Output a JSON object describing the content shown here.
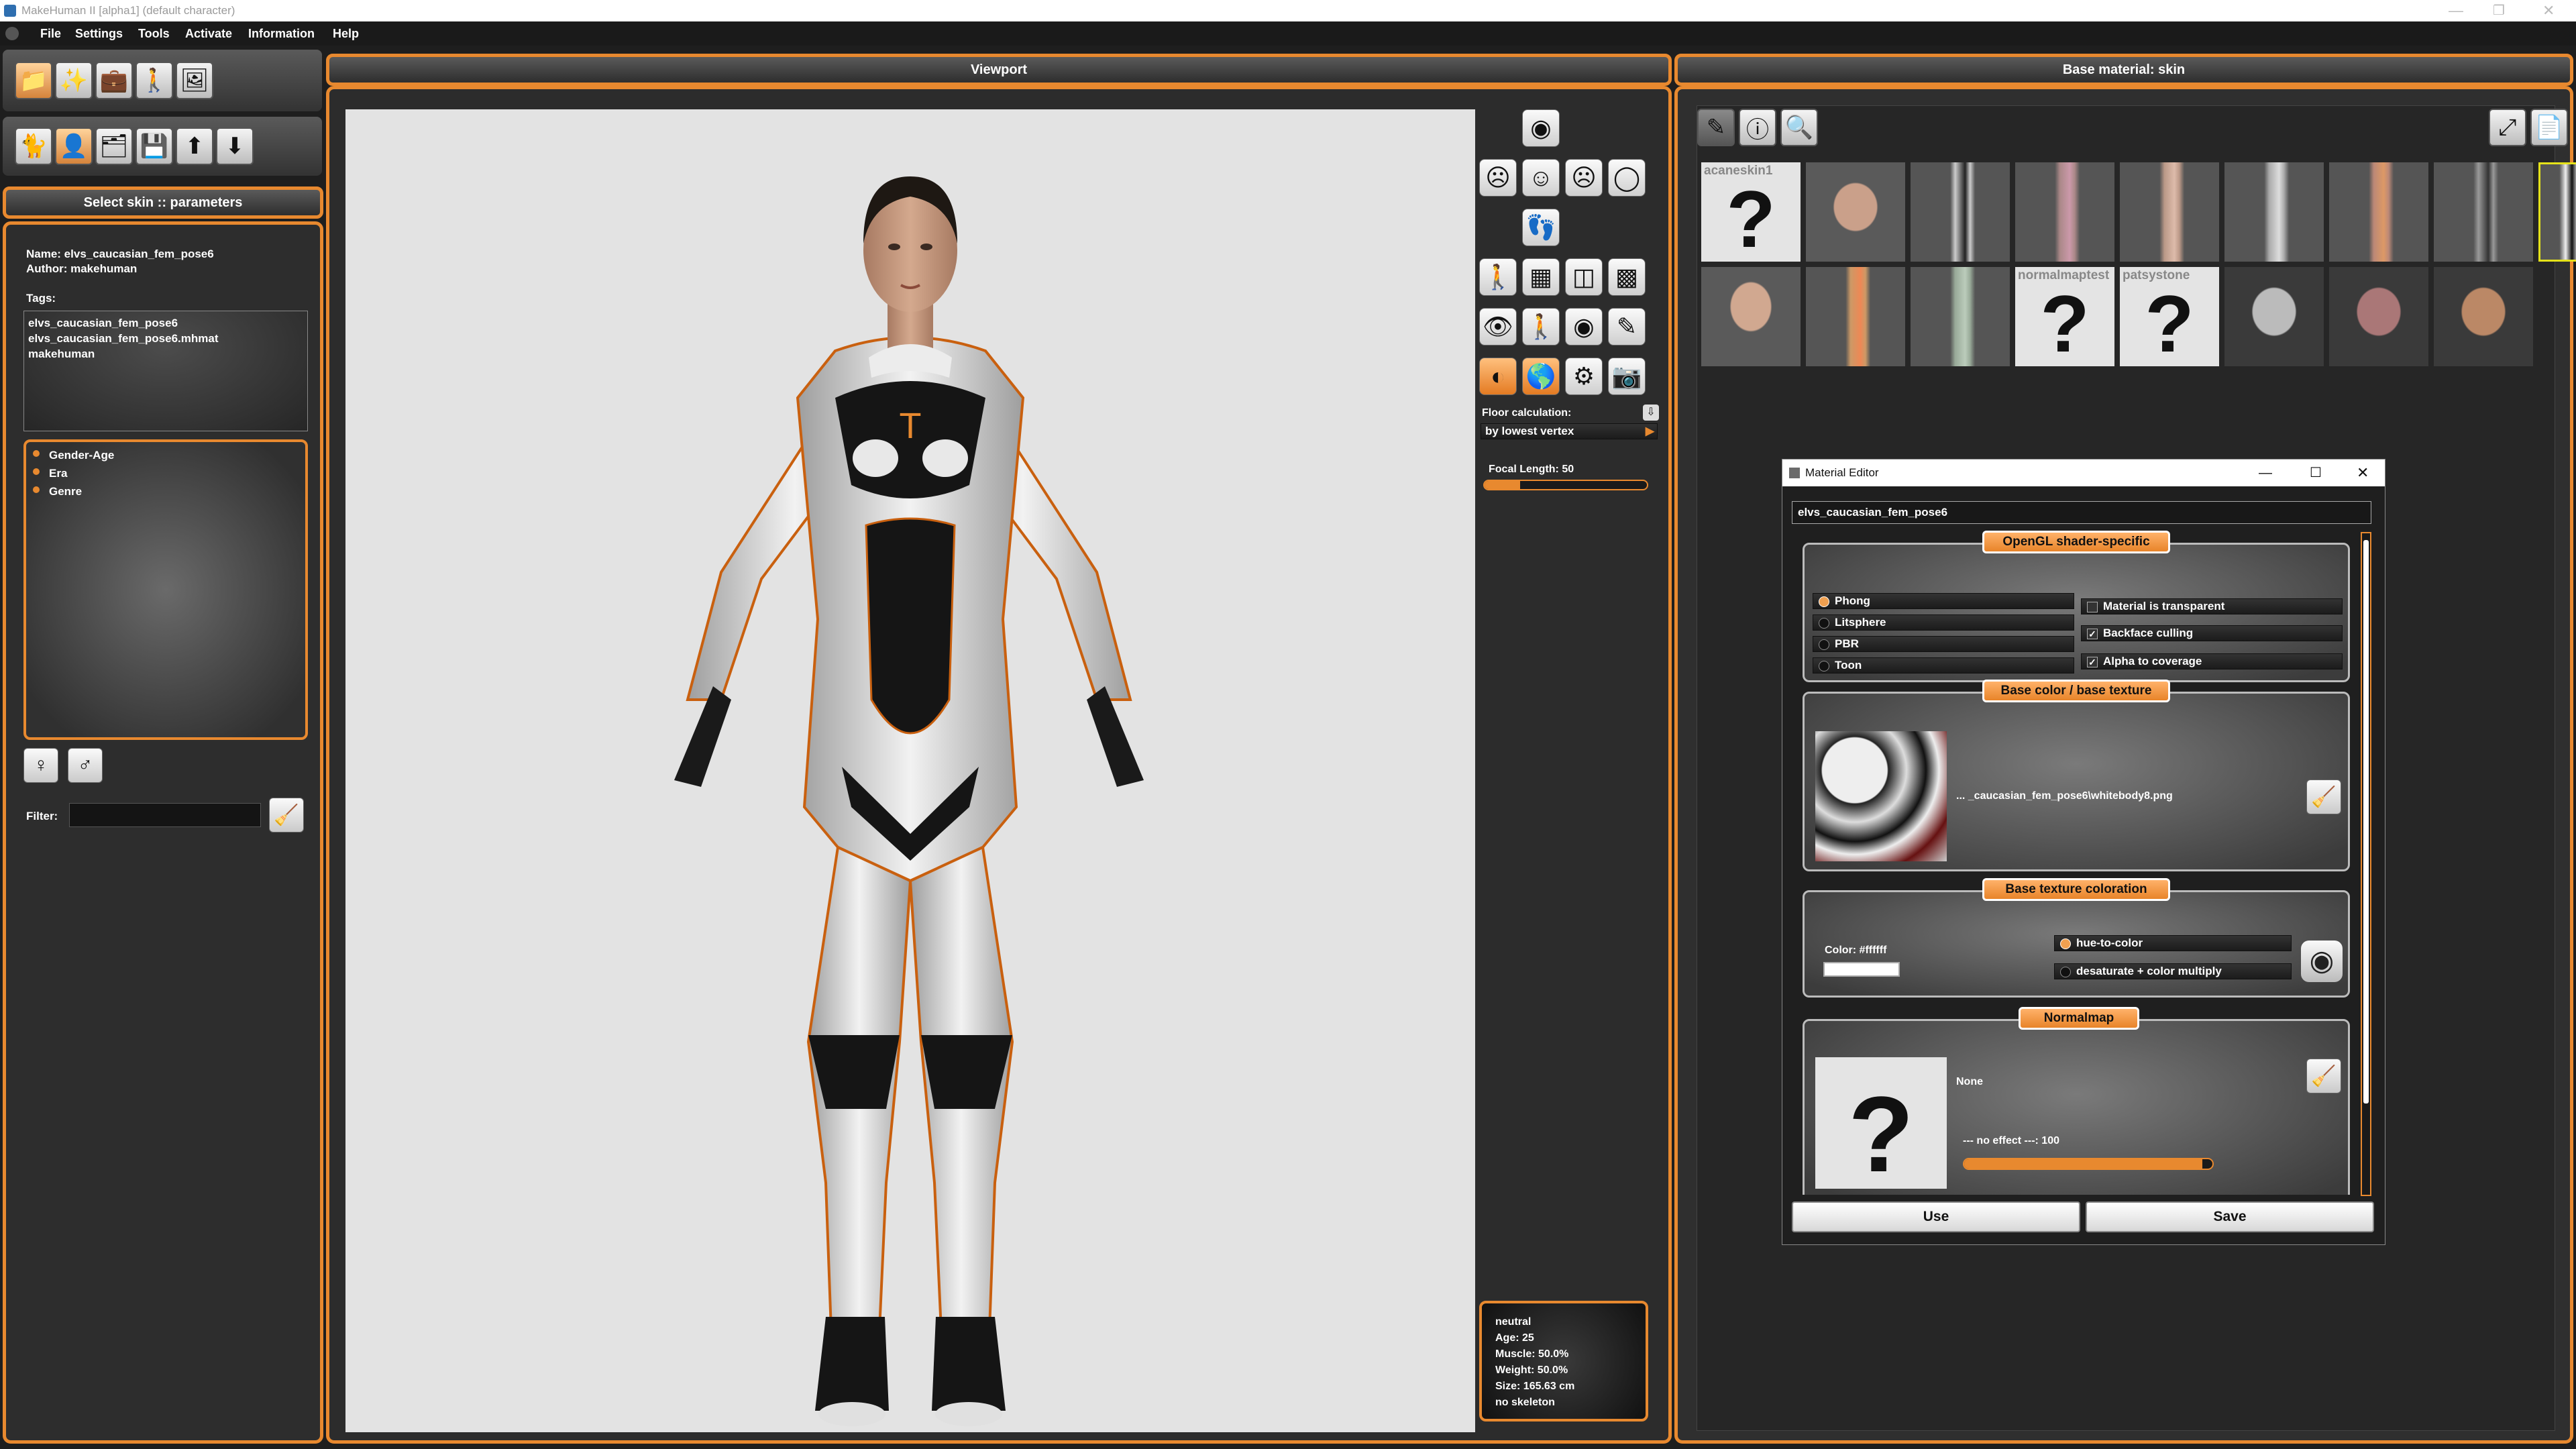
{
  "window": {
    "title": "MakeHuman II [alpha1]  (default character)"
  },
  "menu": [
    "File",
    "Settings",
    "Tools",
    "Activate",
    "Information",
    "Help"
  ],
  "left": {
    "section_title": "Select skin :: parameters",
    "name_line": "Name: elvs_caucasian_fem_pose6",
    "author_line": "Author: makehuman",
    "tags_label": "Tags:",
    "tags": [
      "elvs_caucasian_fem_pose6",
      "elvs_caucasian_fem_pose6.mhmat",
      "makehuman"
    ],
    "categories": [
      "Gender-Age",
      "Era",
      "Genre"
    ],
    "filter_label": "Filter:",
    "filter_value": ""
  },
  "viewport": {
    "title": "Viewport",
    "floor_label": "Floor calculation:",
    "floor_value": "by lowest vertex",
    "focal_label": "Focal Length: 50",
    "focal_level": 0.22,
    "info_lines": [
      "neutral",
      "Age: 25",
      "Muscle: 50.0%",
      "Weight: 50.0%",
      "Size: 165.63 cm",
      "no skeleton"
    ]
  },
  "right": {
    "title": "Base material: skin",
    "grid_labels": {
      "first": "acaneskin1",
      "row2_4": "normalmaptest",
      "row2_5": "patsystone"
    }
  },
  "material_editor": {
    "title": "Material Editor",
    "name_value": "elvs_caucasian_fem_pose6",
    "shader_section": "OpenGL shader-specific",
    "shaders": [
      "Phong",
      "Litsphere",
      "PBR",
      "Toon"
    ],
    "selected_shader": "Phong",
    "options": [
      {
        "label": "Material is transparent",
        "checked": false
      },
      {
        "label": "Backface culling",
        "checked": true
      },
      {
        "label": "Alpha to coverage",
        "checked": true
      }
    ],
    "base_color_section": "Base color / base texture",
    "texture_path": "... _caucasian_fem_pose6\\whitebody8.png",
    "coloration_section": "Base texture coloration",
    "color_label": "Color: #ffffff",
    "color_swatch": "#ffffff",
    "coloration_modes": [
      "hue-to-color",
      "desaturate + color multiply"
    ],
    "normalmap_section": "Normalmap",
    "normalmap_value": "None",
    "normalmap_effect": "--- no effect ---: 100",
    "normalmap_level": 0.96,
    "use_label": "Use",
    "save_label": "Save"
  },
  "colors": {
    "accent": "#e8892f",
    "background": "#1e1e1e",
    "viewport_bg": "#e3e3e3"
  }
}
